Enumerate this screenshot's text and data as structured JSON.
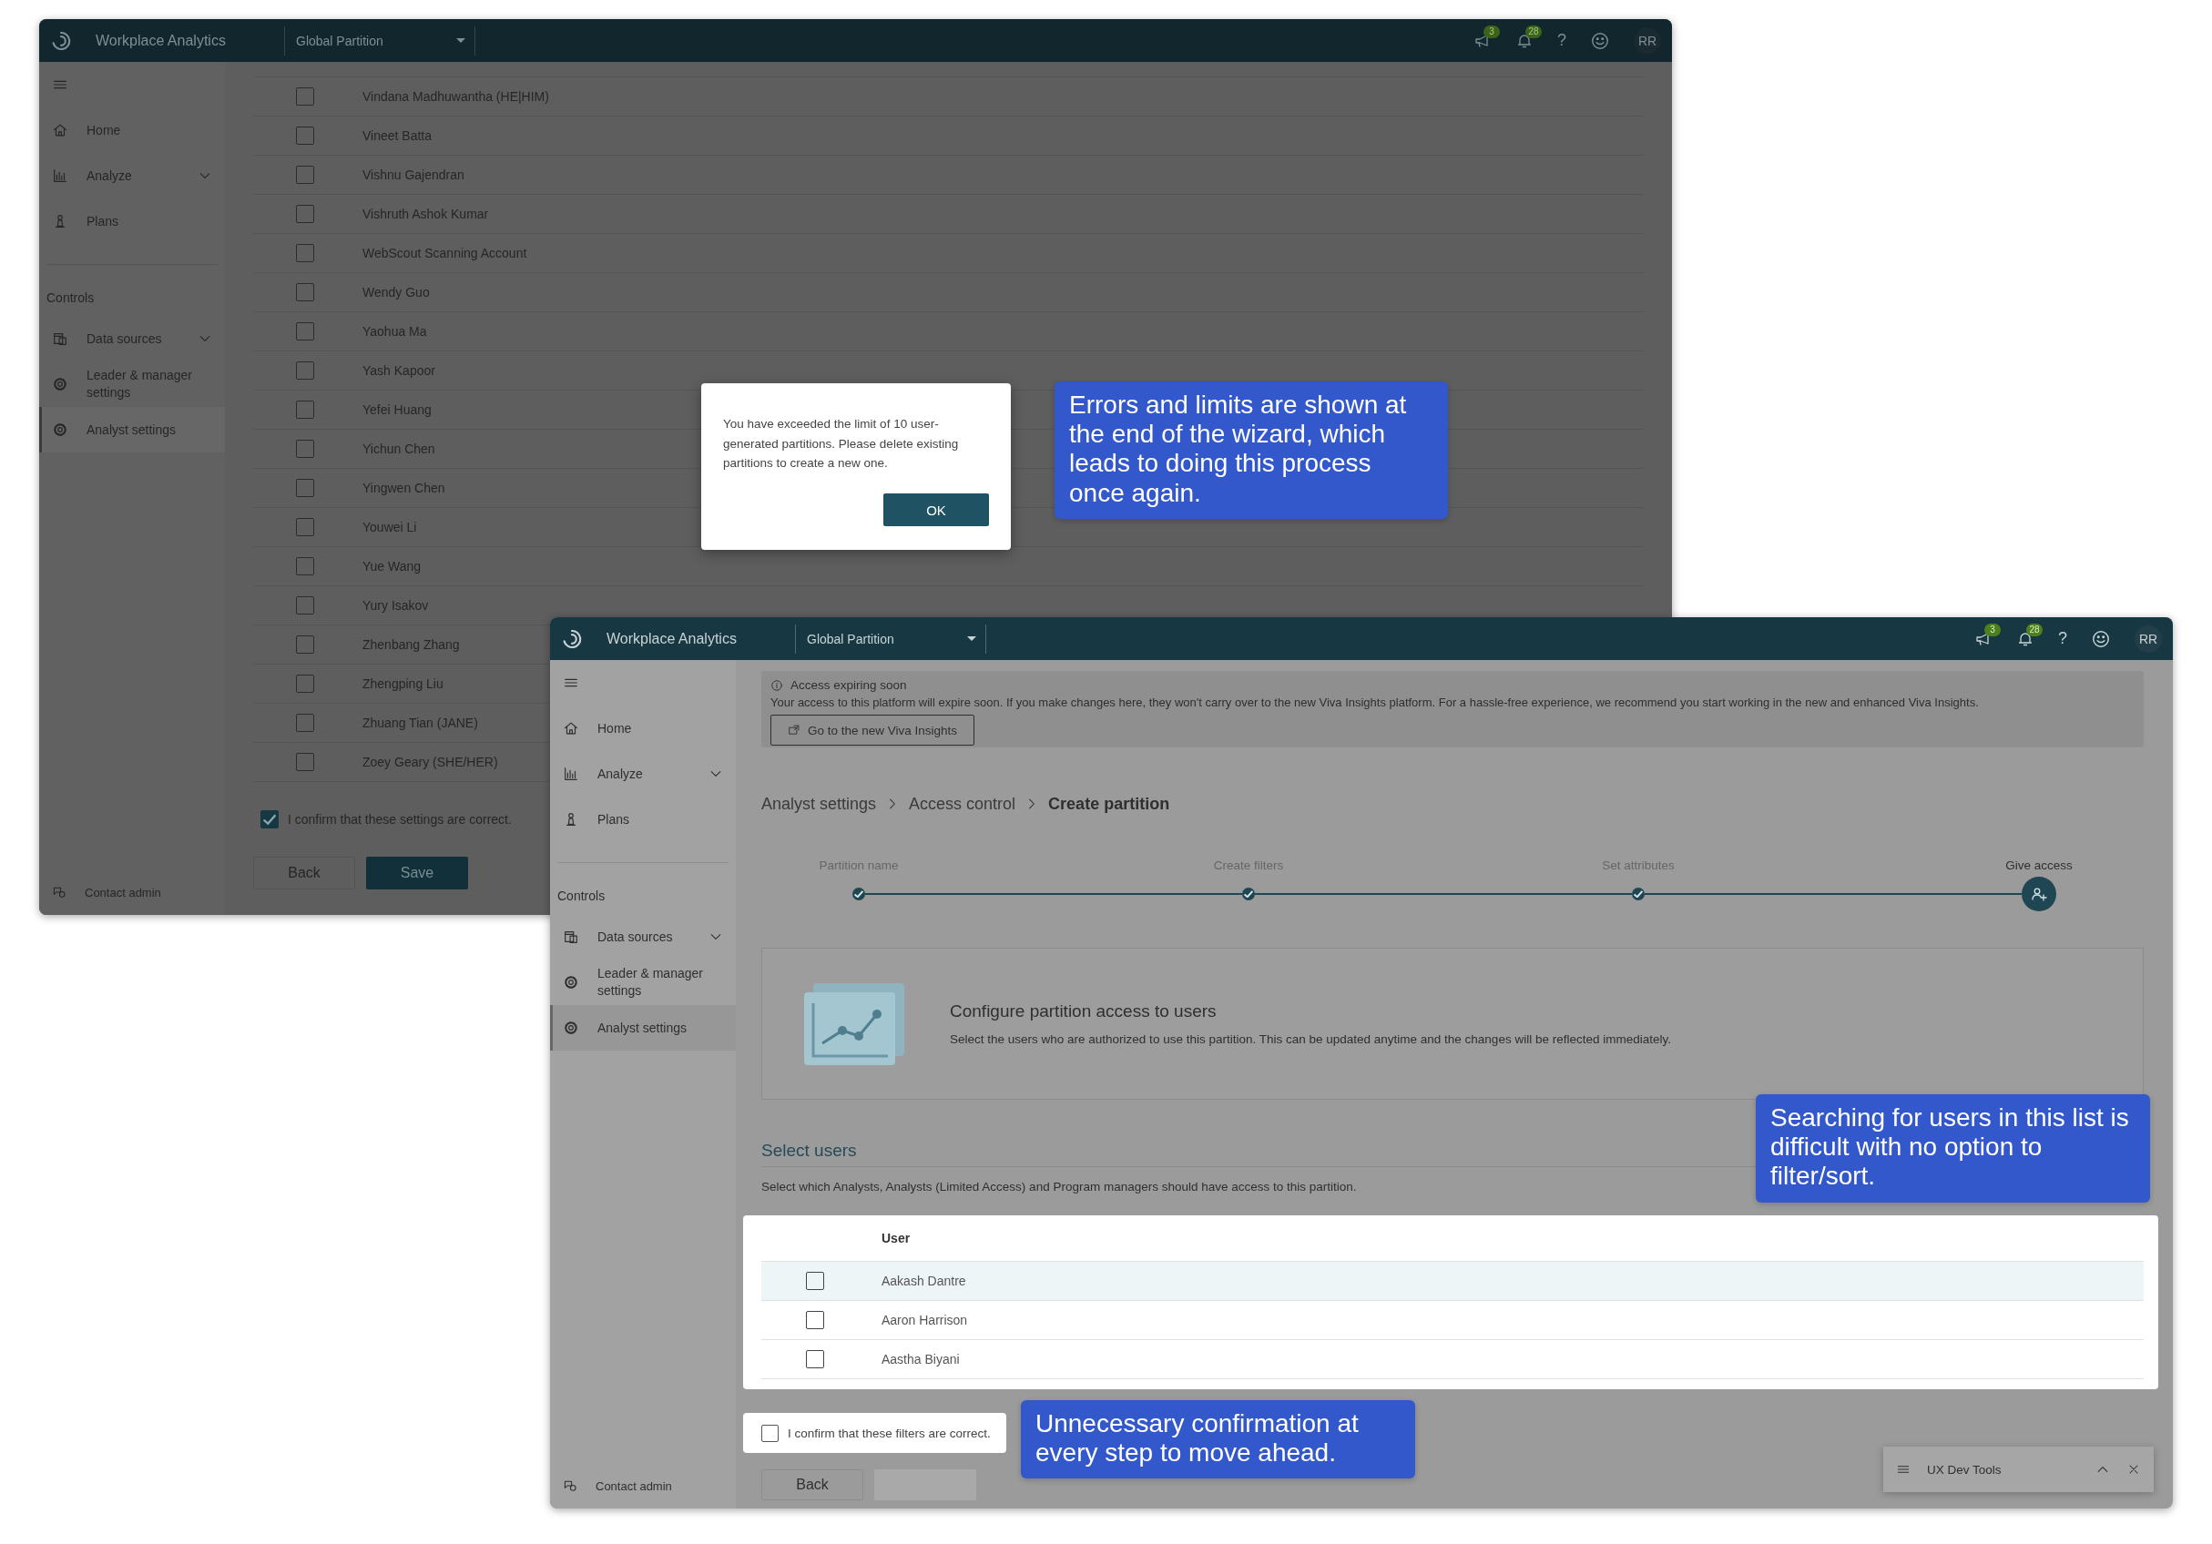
{
  "back_window": {
    "header": {
      "app_title": "Workplace Analytics",
      "partition": "Global Partition",
      "announcements_badge": "3",
      "notifications_badge": "28",
      "help": "?",
      "avatar": "RR"
    },
    "sidebar": {
      "nav": [
        {
          "label": "Home",
          "kind": "home",
          "expandable": false,
          "selected": false
        },
        {
          "label": "Analyze",
          "kind": "chart",
          "expandable": true,
          "selected": false
        },
        {
          "label": "Plans",
          "kind": "plans",
          "expandable": false,
          "selected": false
        }
      ],
      "section_label": "Controls",
      "controls": [
        {
          "label": "Data sources",
          "kind": "data",
          "expandable": true,
          "selected": false
        },
        {
          "label": "Leader & manager settings",
          "kind": "gear",
          "expandable": false,
          "selected": false
        },
        {
          "label": "Analyst settings",
          "kind": "gear",
          "expandable": false,
          "selected": true
        }
      ],
      "footer": "Contact admin"
    },
    "users": [
      {
        "name": "Vindana Madhuwantha (HE|HIM)",
        "checked": false
      },
      {
        "name": "Vineet Batta",
        "checked": false
      },
      {
        "name": "Vishnu Gajendran",
        "checked": false
      },
      {
        "name": "Vishruth Ashok Kumar",
        "checked": false
      },
      {
        "name": "WebScout Scanning Account",
        "checked": false
      },
      {
        "name": "Wendy Guo",
        "checked": false
      },
      {
        "name": "Yaohua Ma",
        "checked": false
      },
      {
        "name": "Yash Kapoor",
        "checked": false
      },
      {
        "name": "Yefei Huang",
        "checked": false
      },
      {
        "name": "Yichun Chen",
        "checked": false
      },
      {
        "name": "Yingwen Chen",
        "checked": false
      },
      {
        "name": "Youwei Li",
        "checked": false
      },
      {
        "name": "Yue Wang",
        "checked": false
      },
      {
        "name": "Yury Isakov",
        "checked": false
      },
      {
        "name": "Zhenbang Zhang",
        "checked": false
      },
      {
        "name": "Zhengping Liu",
        "checked": false
      },
      {
        "name": "Zhuang Tian (JANE)",
        "checked": false
      },
      {
        "name": "Zoey Geary (SHE/HER)",
        "checked": false
      }
    ],
    "confirm": {
      "label": "I confirm that these settings are correct.",
      "checked": true
    },
    "buttons": {
      "back": "Back",
      "save": "Save"
    },
    "dialog": {
      "message": "You have exceeded the limit of 10 user-generated partitions. Please delete existing partitions to create a new one.",
      "button": "OK"
    }
  },
  "front_window": {
    "header": {
      "app_title": "Workplace Analytics",
      "partition": "Global Partition",
      "announcements_badge": "3",
      "notifications_badge": "28",
      "help": "?",
      "avatar": "RR"
    },
    "sidebar": {
      "nav": [
        {
          "label": "Home",
          "kind": "home",
          "expandable": false,
          "selected": false
        },
        {
          "label": "Analyze",
          "kind": "chart",
          "expandable": true,
          "selected": false
        },
        {
          "label": "Plans",
          "kind": "plans",
          "expandable": false,
          "selected": false
        }
      ],
      "section_label": "Controls",
      "controls": [
        {
          "label": "Data sources",
          "kind": "data",
          "expandable": true,
          "selected": false
        },
        {
          "label": "Leader & manager settings",
          "kind": "gear",
          "expandable": false,
          "selected": false
        },
        {
          "label": "Analyst settings",
          "kind": "gear",
          "expandable": false,
          "selected": true
        }
      ],
      "footer": "Contact admin"
    },
    "banner": {
      "title": "Access expiring soon",
      "message": "Your access to this platform will expire soon. If you make changes here, they won't carry over to the new Viva Insights platform. For a hassle-free experience, we recommend you start working in the new and enhanced Viva Insights.",
      "button": "Go to the new Viva Insights"
    },
    "breadcrumb": [
      {
        "label": "Analyst settings",
        "current": false
      },
      {
        "label": "Access control",
        "current": false
      },
      {
        "label": "Create partition",
        "current": true
      }
    ],
    "steps": [
      {
        "label": "Partition name",
        "current": false
      },
      {
        "label": "Create filters",
        "current": false
      },
      {
        "label": "Set attributes",
        "current": false
      },
      {
        "label": "Give access",
        "current": true
      }
    ],
    "intro": {
      "title": "Configure partition access to users",
      "description": "Select the users who are authorized to use this partition. This can be updated anytime and the changes will be reflected immediately."
    },
    "select_users": {
      "heading": "Select users",
      "description": "Select which Analysts, Analysts (Limited Access) and Program managers should have access to this partition."
    },
    "table": {
      "columns": [
        "User"
      ],
      "rows": [
        {
          "name": "Aakash Dantre",
          "checked": false,
          "highlighted": true
        },
        {
          "name": "Aaron Harrison",
          "checked": false,
          "highlighted": false
        },
        {
          "name": "Aastha Biyani",
          "checked": false,
          "highlighted": false
        }
      ]
    },
    "confirm": {
      "label": "I confirm that these filters are correct.",
      "checked": false
    },
    "buttons": {
      "back": "Back"
    },
    "dev_tools": {
      "title": "UX Dev Tools"
    }
  },
  "annotations": [
    {
      "text": "Errors and limits are shown at the end of the wizard, which leads to doing this process once again."
    },
    {
      "text": "Searching for users in this list is difficult with no option to filter/sort."
    },
    {
      "text": "Unnecessary confirmation at every step to move ahead."
    }
  ]
}
